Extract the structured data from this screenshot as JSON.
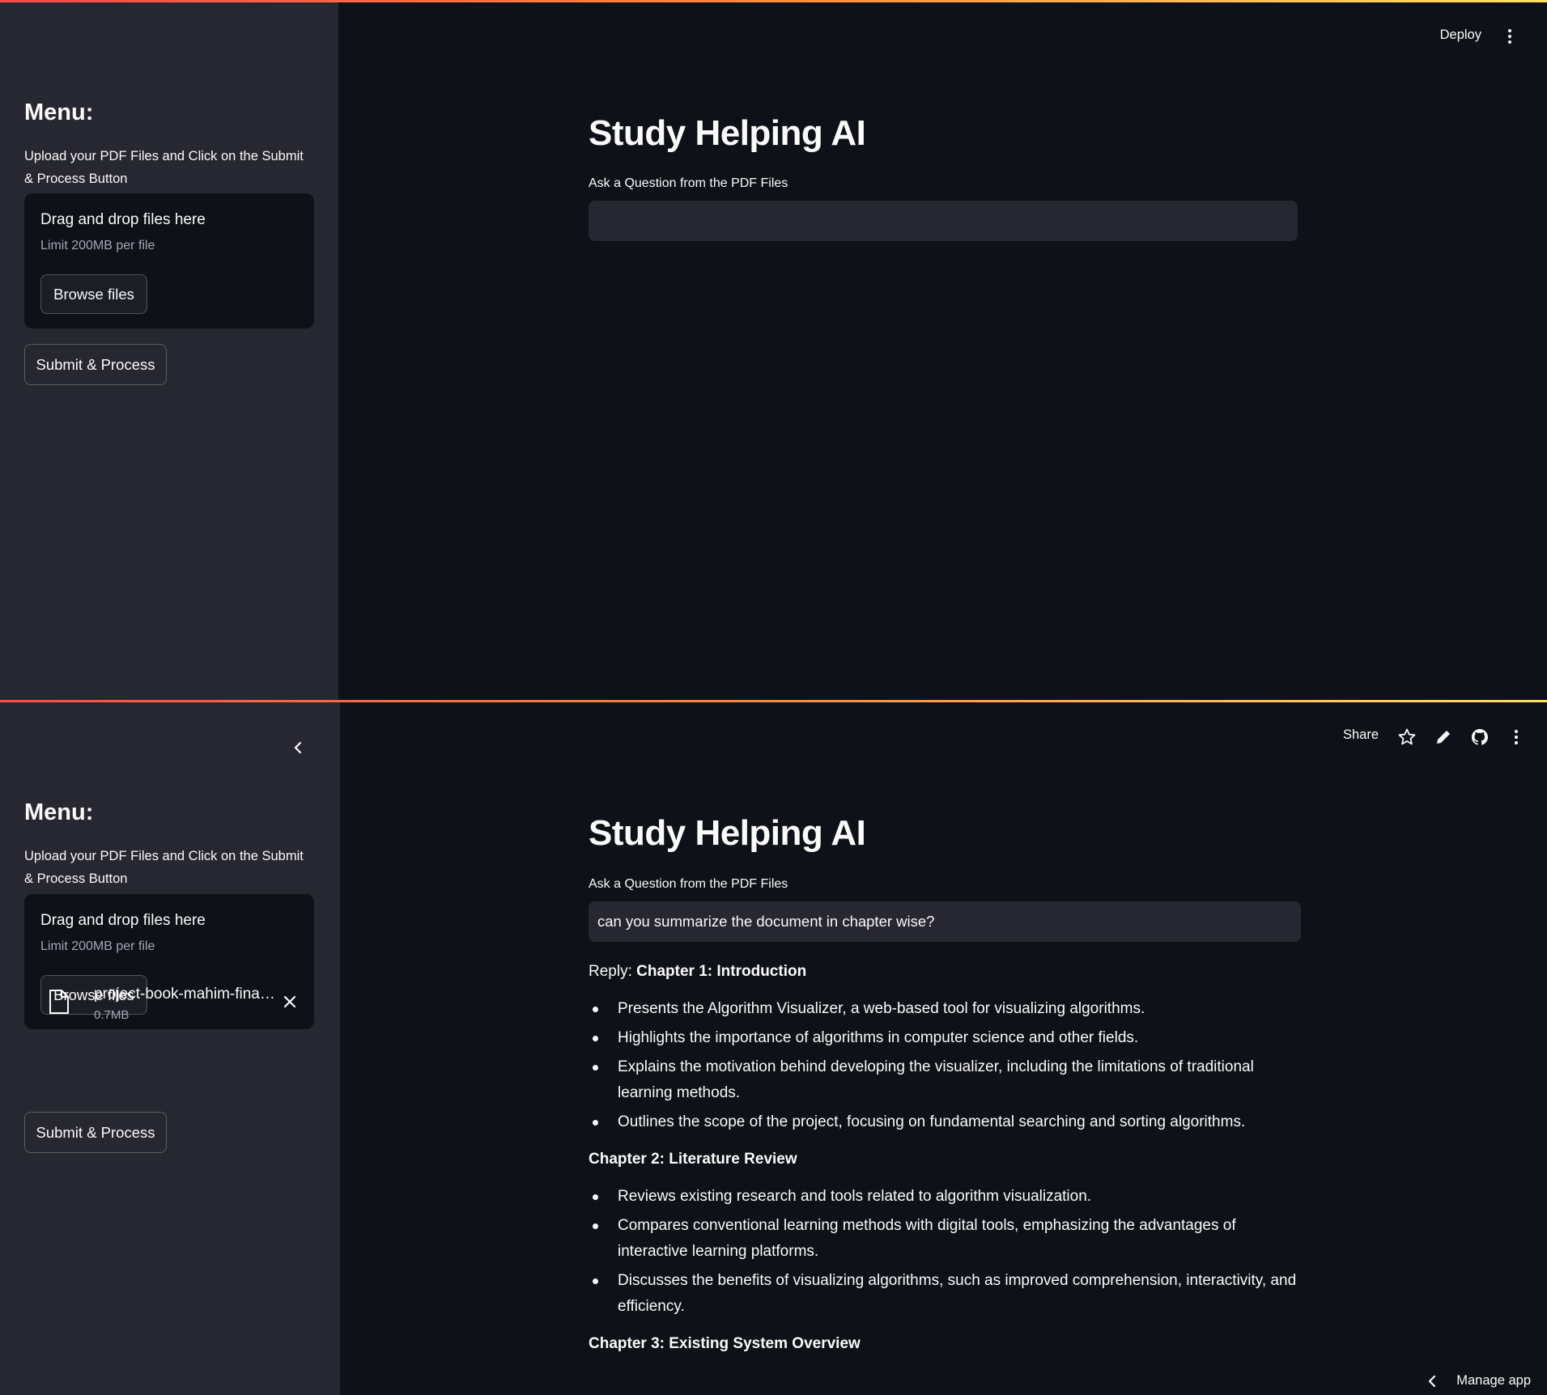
{
  "screen1": {
    "header": {
      "deploy_label": "Deploy"
    },
    "sidebar": {
      "menu_title": "Menu:",
      "upload_description": "Upload your PDF Files and Click on the Submit & Process Button",
      "dropzone": {
        "title": "Drag and drop files here",
        "limit": "Limit 200MB per file",
        "browse_label": "Browse files"
      },
      "submit_label": "Submit & Process"
    },
    "main": {
      "title": "Study Helping AI",
      "question_label": "Ask a Question from the PDF Files",
      "question_value": ""
    }
  },
  "screen2": {
    "header": {
      "share_label": "Share"
    },
    "sidebar": {
      "menu_title": "Menu:",
      "upload_description": "Upload your PDF Files and Click on the Submit & Process Button",
      "dropzone": {
        "title": "Drag and drop files here",
        "limit": "Limit 200MB per file",
        "browse_label": "Browse files"
      },
      "uploaded_file": {
        "name": "project-book-mahim-fina…",
        "size": "0.7MB"
      },
      "submit_label": "Submit & Process"
    },
    "main": {
      "title": "Study Helping AI",
      "question_label": "Ask a Question from the PDF Files",
      "question_value": "can you summarize the document in chapter wise?",
      "reply_prefix": "Reply: ",
      "chapters": [
        {
          "heading": "Chapter 1: Introduction",
          "bullets": [
            "Presents the Algorithm Visualizer, a web-based tool for visualizing algorithms.",
            "Highlights the importance of algorithms in computer science and other fields.",
            "Explains the motivation behind developing the visualizer, including the limitations of traditional learning methods.",
            "Outlines the scope of the project, focusing on fundamental searching and sorting algorithms."
          ]
        },
        {
          "heading": "Chapter 2: Literature Review",
          "bullets": [
            "Reviews existing research and tools related to algorithm visualization.",
            "Compares conventional learning methods with digital tools, emphasizing the advantages of interactive learning platforms.",
            "Discusses the benefits of visualizing algorithms, such as improved comprehension, interactivity, and efficiency."
          ]
        },
        {
          "heading": "Chapter 3: Existing System Overview",
          "bullets": []
        }
      ]
    },
    "footer": {
      "manage_label": "Manage app"
    }
  },
  "icons": {
    "kebab": "more-vertical-icon",
    "collapse": "chevron-left-icon",
    "star": "star-icon",
    "edit": "pencil-icon",
    "github": "github-icon",
    "file": "file-icon",
    "remove": "close-icon"
  },
  "colors": {
    "background": "#0e1117",
    "sidebar": "#262730",
    "input": "#262730",
    "text": "#fafafa",
    "muted": "#a3a8b8",
    "accent_gradient_start": "#ff4b4b",
    "accent_gradient_end": "#ffe066"
  }
}
